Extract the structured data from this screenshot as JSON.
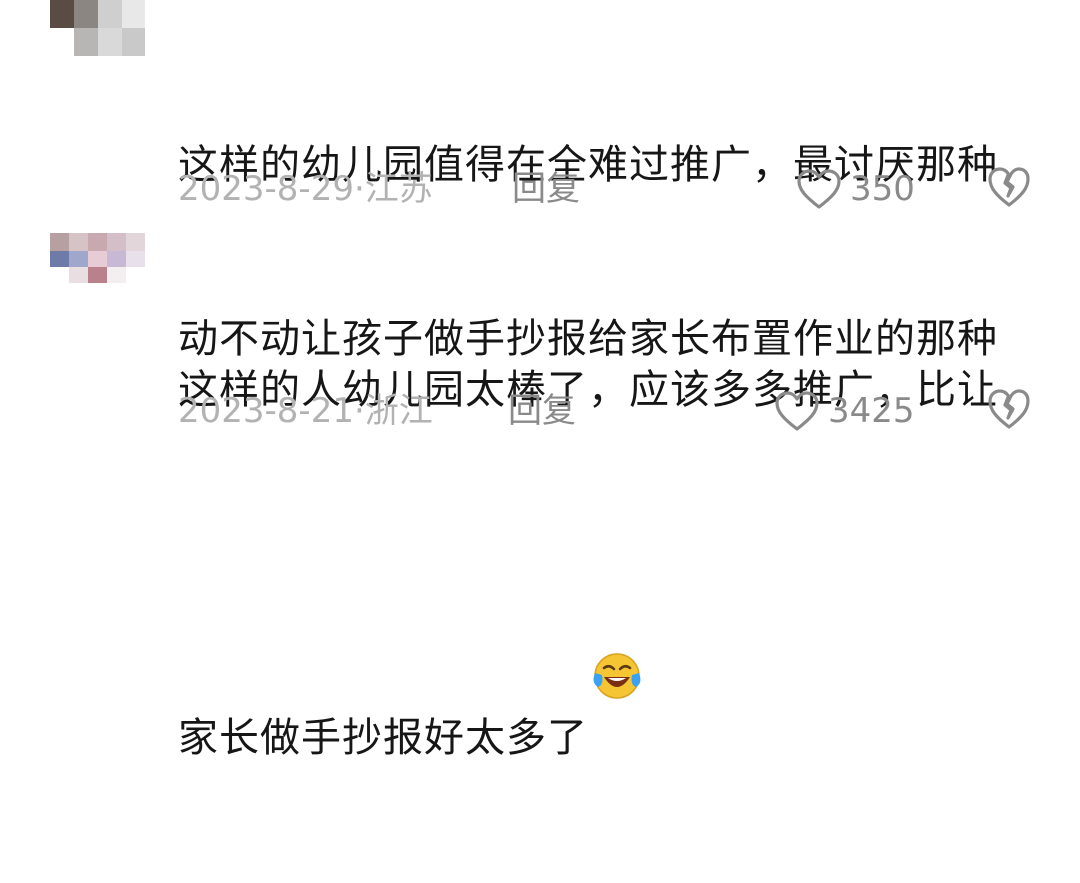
{
  "comments": [
    {
      "text_line1": "这样的幼儿园值得在全难过推广，最讨厌那种",
      "text_line2": "动不动让孩子做手抄报给家长布置作业的那种",
      "date": "2023-8-29",
      "separator": "·",
      "location": "江苏",
      "reply_label": "回复",
      "like_count": "350",
      "avatar_icon": "blurred-avatar",
      "like_icon": "heart-outline-icon",
      "dislike_icon": "broken-heart-icon"
    },
    {
      "text_line1": "这样的人幼儿园太棒了，应该多多推广，比让",
      "text_line2": "家长做手抄报好太多了",
      "emoji": "laughing-crying-emoji",
      "date": "2023-8-21",
      "separator": "·",
      "location": "浙江",
      "reply_label": "回复",
      "like_count": "3425",
      "avatar_icon": "blurred-avatar",
      "like_icon": "heart-outline-icon",
      "dislike_icon": "broken-heart-icon"
    }
  ],
  "colors": {
    "text": "#161616",
    "meta": "#b2b2b2",
    "action": "#8a8a8a",
    "emoji_face": "#f6c533",
    "emoji_tear": "#3aa2f0"
  }
}
